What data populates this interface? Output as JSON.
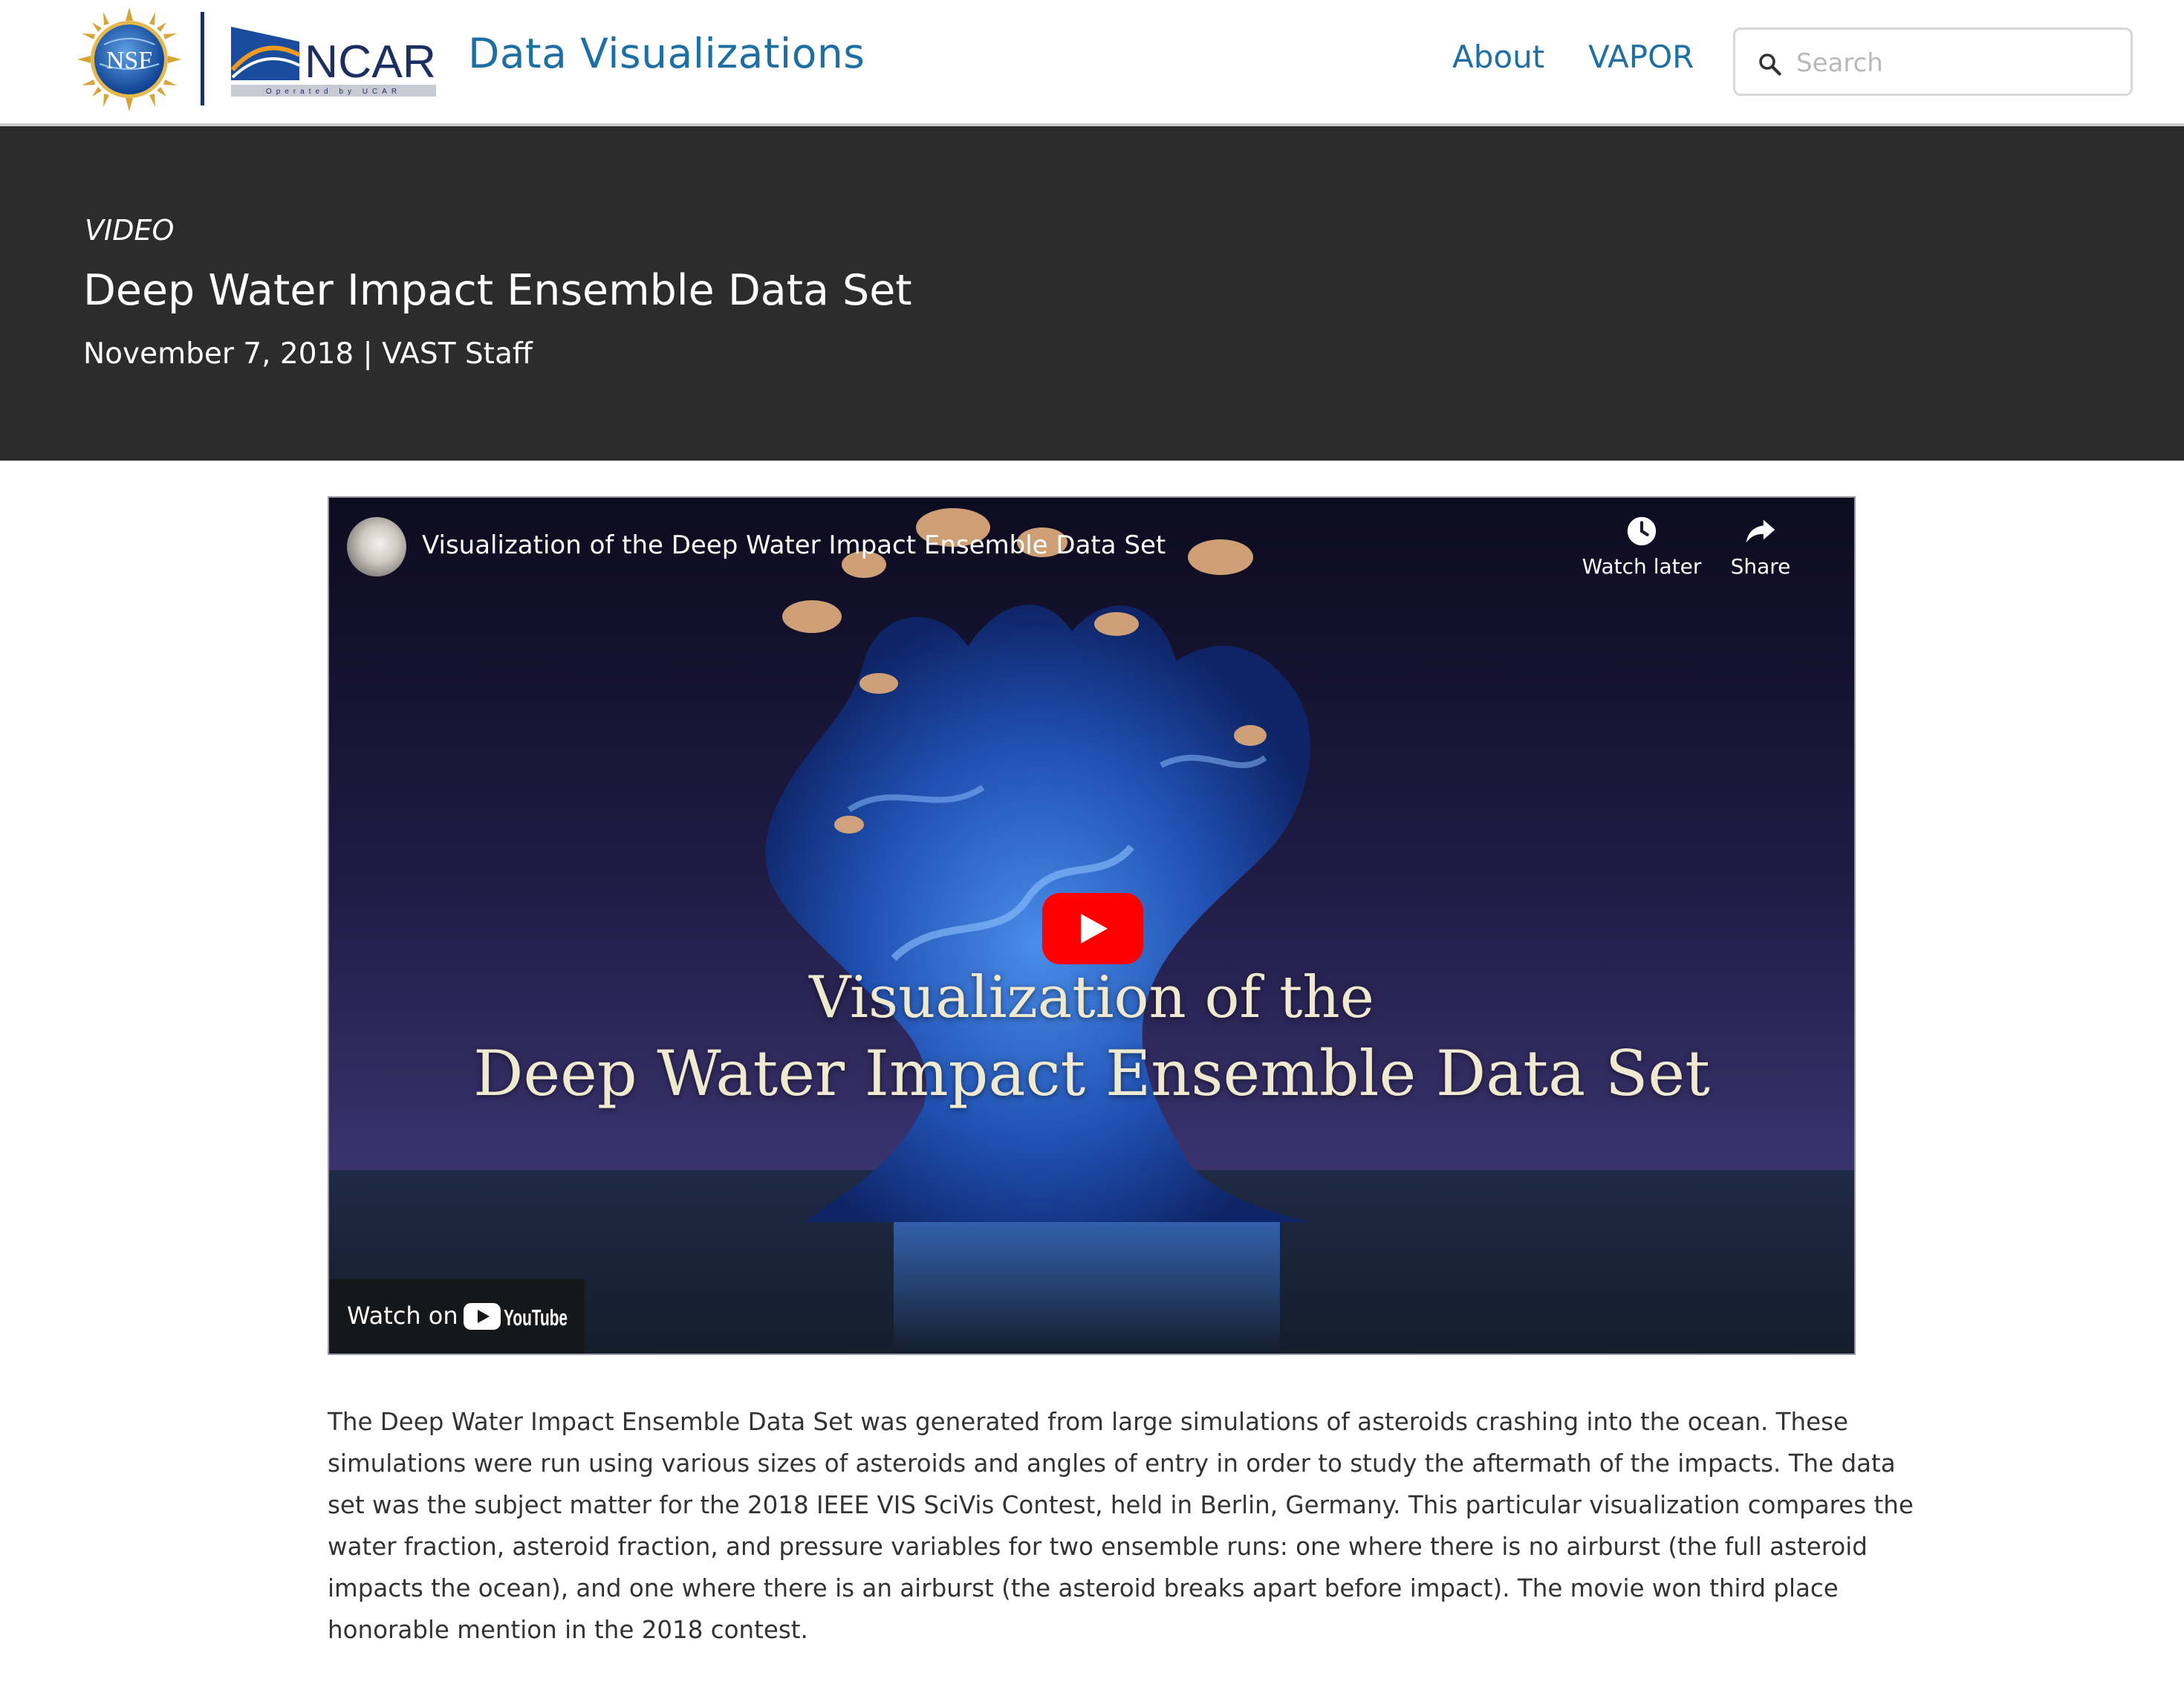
{
  "header": {
    "nsf_logo": {
      "icon": "nsf-logo",
      "text": "NSF"
    },
    "ncar_logo": {
      "icon": "ncar-logo",
      "text": "NCAR",
      "subtext": "Operated by UCAR"
    },
    "site_title": "Data Visualizations",
    "nav": [
      {
        "label": "About"
      },
      {
        "label": "VAPOR"
      }
    ],
    "search": {
      "placeholder": "Search",
      "value": "",
      "icon": "search-icon"
    }
  },
  "hero": {
    "kicker": "VIDEO",
    "title": "Deep Water Impact Ensemble Data Set",
    "meta": "November 7, 2018 | VAST Staff"
  },
  "video": {
    "title": "Visualization of the Deep Water Impact Ensemble Data Set",
    "watch_later_label": "Watch later",
    "share_label": "Share",
    "overlay_line1": "Visualization of the",
    "overlay_line2": "Deep Water Impact Ensemble Data Set",
    "watch_on_label": "Watch on",
    "youtube_wordmark": "YouTube",
    "colors": {
      "play": "#ff0000",
      "overlay_text": "#eee9cf"
    }
  },
  "description": {
    "lines": [
      "The Deep Water Impact Ensemble Data Set was generated from large simulations of asteroids crashing into the ocean. These",
      "simulations were run using various sizes of asteroids and angles of entry in order to study the aftermath of the impacts. The data",
      "set was the subject matter for the 2018 IEEE VIS SciVis Contest, held in Berlin, Germany. This particular visualization compares the",
      "water fraction, asteroid fraction, and pressure variables for two ensemble runs: one where there is no airburst (the full asteroid",
      "impacts the ocean), and one where there is an airburst (the asteroid breaks apart before impact). The movie won third place",
      "honorable mention in the 2018 contest."
    ]
  },
  "colors": {
    "link": "#1d6fa4",
    "hero_bg": "#2c2c2c",
    "text": "#333333"
  }
}
